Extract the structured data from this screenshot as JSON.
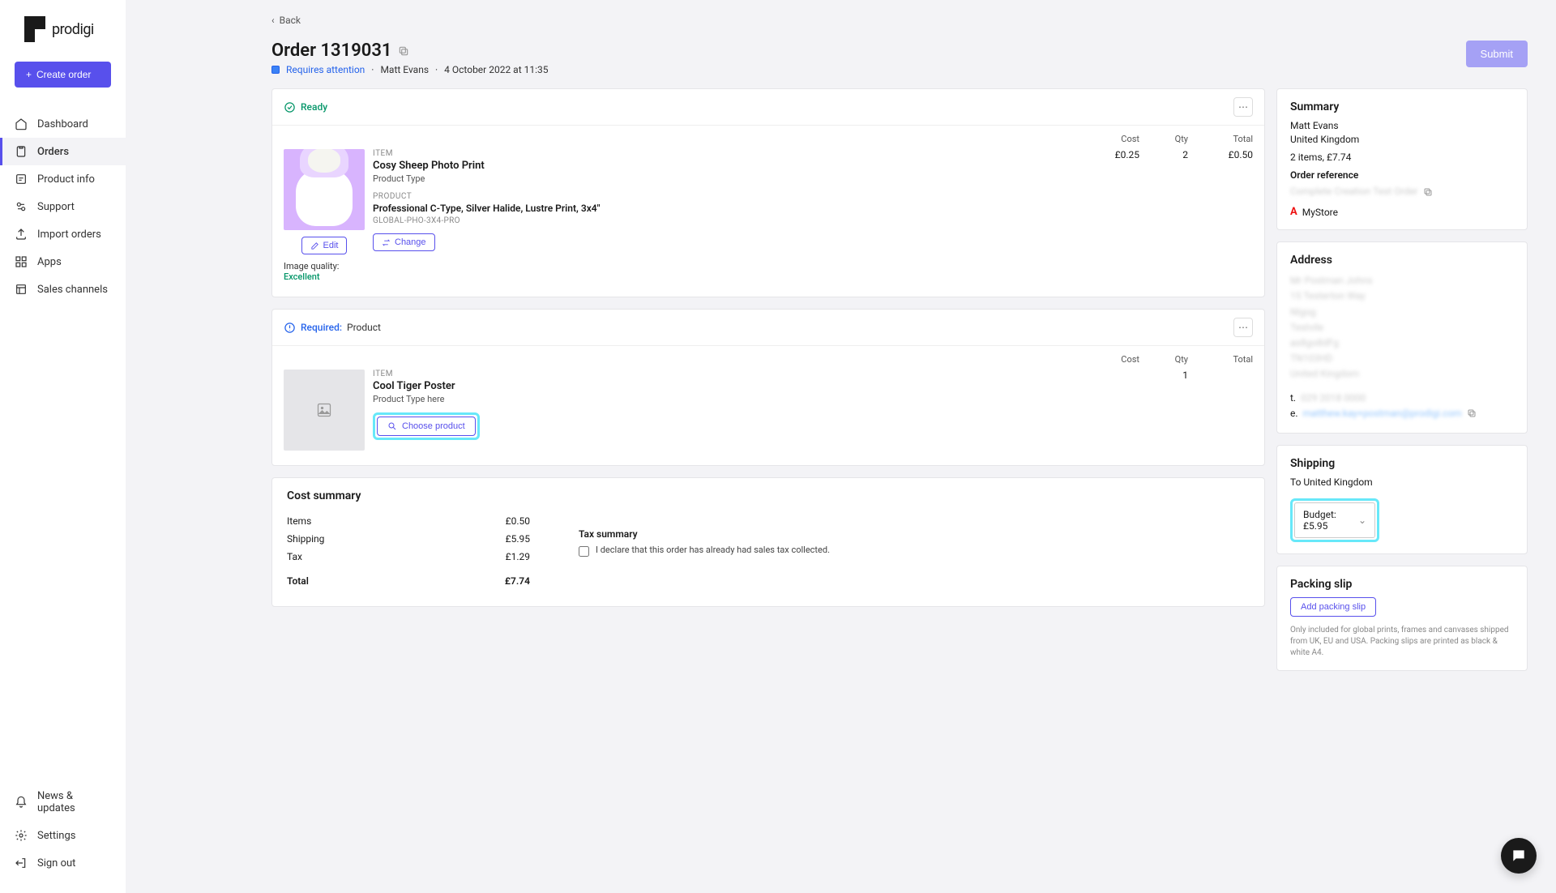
{
  "brand": {
    "name": "prodigi"
  },
  "sidebar": {
    "create_label": "Create order",
    "nav": [
      {
        "label": "Dashboard"
      },
      {
        "label": "Orders"
      },
      {
        "label": "Product info"
      },
      {
        "label": "Support"
      },
      {
        "label": "Import orders"
      },
      {
        "label": "Apps"
      },
      {
        "label": "Sales channels"
      }
    ],
    "bottom": [
      {
        "label": "News & updates"
      },
      {
        "label": "Settings"
      },
      {
        "label": "Sign out"
      }
    ]
  },
  "back_label": "Back",
  "page_title": "Order 1319031",
  "status_text": "Requires attention",
  "customer_name": "Matt Evans",
  "timestamp": "4 October 2022 at 11:35",
  "submit_label": "Submit",
  "shipment1": {
    "status": "Ready",
    "cols": {
      "cost": "Cost",
      "qty": "Qty",
      "total": "Total"
    },
    "item_label": "ITEM",
    "item_name": "Cosy Sheep Photo Print",
    "item_type": "Product Type",
    "product_label": "PRODUCT",
    "product_desc": "Professional C-Type, Silver Halide, Lustre Print, 3x4\"",
    "sku": "GLOBAL-PHO-3X4-PRO",
    "cost": "£0.25",
    "qty": "2",
    "total": "£0.50",
    "edit_label": "Edit",
    "change_label": "Change",
    "quality_label": "Image quality: ",
    "quality_value": "Excellent"
  },
  "shipment2": {
    "status_prefix": "Required:",
    "status_suffix": "Product",
    "cols": {
      "cost": "Cost",
      "qty": "Qty",
      "total": "Total"
    },
    "item_label": "ITEM",
    "item_name": "Cool Tiger Poster",
    "item_type": "Product Type here",
    "qty": "1",
    "choose_label": "Choose product"
  },
  "cost": {
    "title": "Cost summary",
    "rows": {
      "items_label": "Items",
      "items_val": "£0.50",
      "shipping_label": "Shipping",
      "shipping_val": "£5.95",
      "tax_label": "Tax",
      "tax_val": "£1.29",
      "total_label": "Total",
      "total_val": "£7.74"
    },
    "tax_title": "Tax summary",
    "tax_checkbox": "I declare that this order has already had sales tax collected."
  },
  "summary": {
    "title": "Summary",
    "name": "Matt Evans",
    "country": "United Kingdom",
    "items_line": "2 items, £7.74",
    "ref_label": "Order reference",
    "ref_val": "Complete Creation Test Order",
    "store": "MyStore"
  },
  "address": {
    "title": "Address",
    "lines": "Mr Postman Johns\n15 Testerton Way\nNlgog\nTestvile\nas8go8dFg\nTN103HD\nUnited Kingdom",
    "tel_label": "t.",
    "tel": "029 2018 0000",
    "email_label": "e.",
    "email": "matthew.kay+postman@prodigi.com"
  },
  "shipping": {
    "title": "Shipping",
    "to": "To United Kingdom",
    "option": "Budget: £5.95"
  },
  "packing": {
    "title": "Packing slip",
    "btn": "Add packing slip",
    "note": "Only included for global prints, frames and canvases shipped from UK, EU and USA. Packing slips are printed as black & white A4."
  }
}
